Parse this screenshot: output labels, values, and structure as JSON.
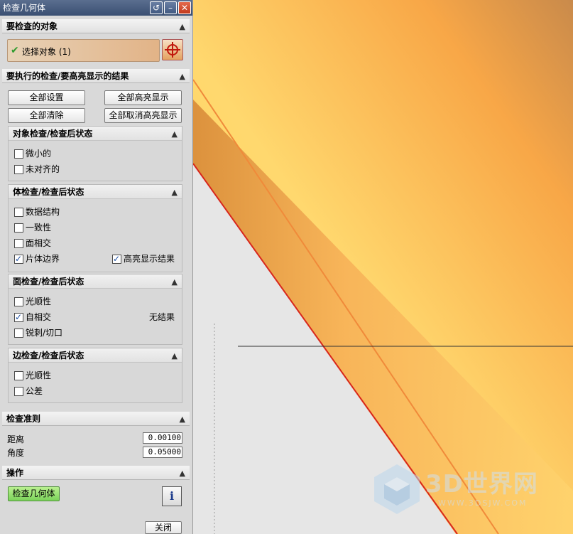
{
  "window": {
    "title": "检查几何体"
  },
  "sections": {
    "objects": {
      "title": "要检查的对象",
      "select_label": "选择对象 (1)"
    },
    "checks": {
      "title": "要执行的检查/要高亮显示的结果",
      "buttons": {
        "set_all": "全部设置",
        "highlight_all": "全部高亮显示",
        "clear_all": "全部清除",
        "unhighlight_all": "全部取消高亮显示"
      }
    },
    "object_check": {
      "title": "对象检查/检查后状态",
      "items": [
        "微小的",
        "未对齐的"
      ]
    },
    "body_check": {
      "title": "体检查/检查后状态",
      "items": [
        "数据结构",
        "一致性",
        "面相交",
        "片体边界"
      ],
      "highlight_label": "高亮显示结果"
    },
    "face_check": {
      "title": "面检查/检查后状态",
      "items": [
        "光顺性",
        "自相交",
        "锐刺/切口"
      ],
      "no_result": "无结果"
    },
    "edge_check": {
      "title": "边检查/检查后状态",
      "items": [
        "光顺性",
        "公差"
      ]
    },
    "criteria": {
      "title": "检查准则",
      "distance_label": "距离",
      "distance_value": "0.00100",
      "angle_label": "角度",
      "angle_value": "0.05000"
    },
    "operation": {
      "title": "操作",
      "check_button": "检查几何体"
    }
  },
  "footer": {
    "close_button": "关闭"
  },
  "watermark": {
    "brand": "3D世界网",
    "url": "WWW.3DSJW.COM"
  },
  "colors": {
    "surface_light": "#ffe07a",
    "surface_mid": "#f7a645",
    "surface_dark": "#c07a35",
    "edge_red": "#d8261c"
  }
}
